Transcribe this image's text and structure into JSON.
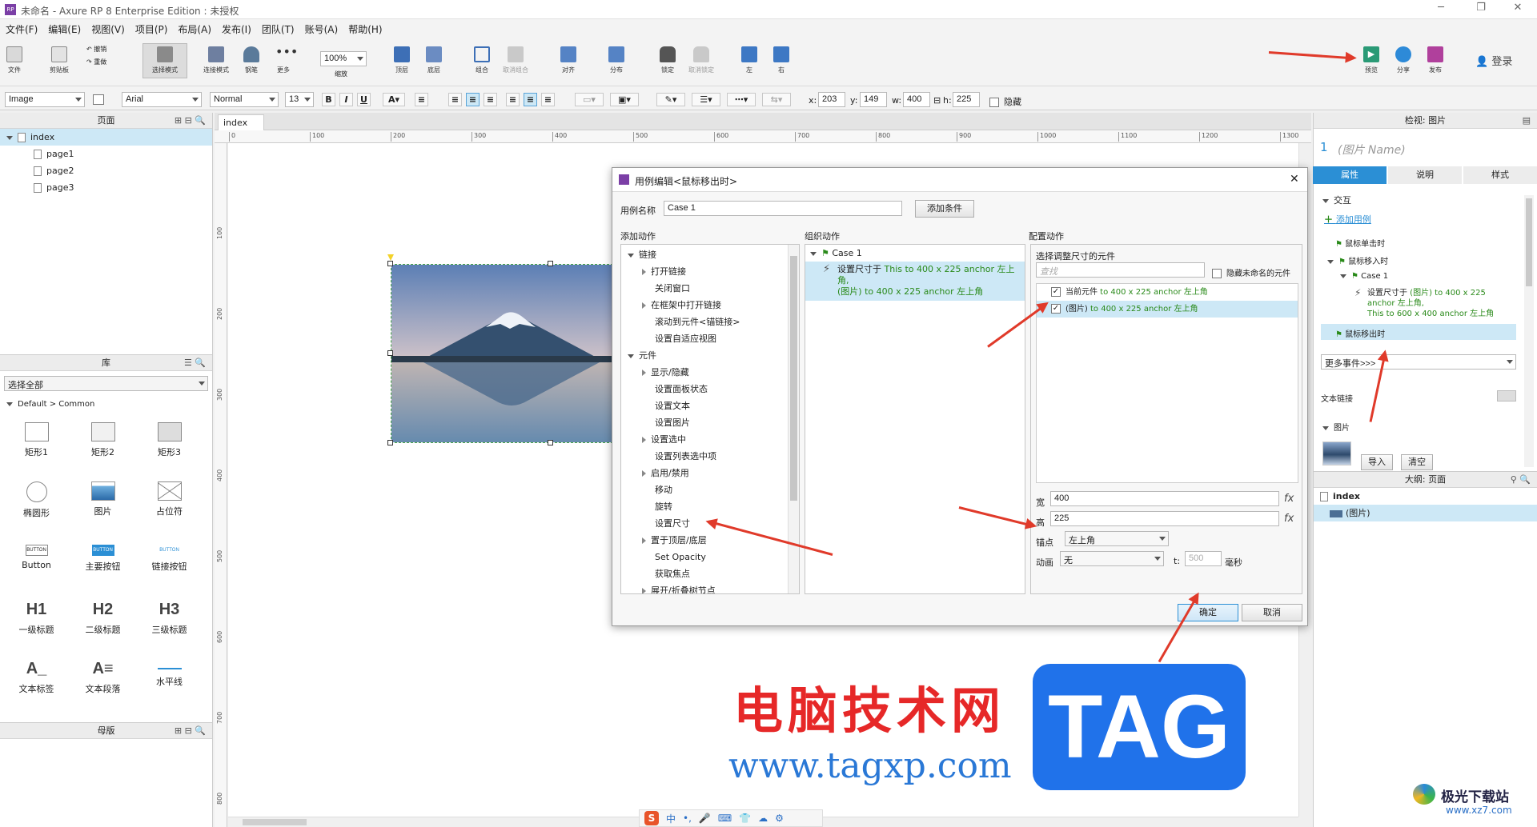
{
  "window": {
    "title": "未命名 - Axure RP 8 Enterprise Edition : 未授权",
    "logo": "RP"
  },
  "menu": [
    "文件(F)",
    "编辑(E)",
    "视图(V)",
    "项目(P)",
    "布局(A)",
    "发布(I)",
    "团队(T)",
    "账号(A)",
    "帮助(H)"
  ],
  "toolbar": {
    "file": "文件",
    "clipboard": "剪贴板",
    "undo": "撤销",
    "redo": "重做",
    "select_mode": "选择模式",
    "connect_mode": "连接模式",
    "pen": "钢笔",
    "more": "更多",
    "zoom_value": "100%",
    "zoom_label": "缩放",
    "top": "顶层",
    "bottom": "底层",
    "group": "组合",
    "ungroup": "取消组合",
    "align": "对齐",
    "distribute": "分布",
    "lock": "锁定",
    "unlock": "取消锁定",
    "left": "左",
    "right": "右",
    "preview": "预览",
    "share": "分享",
    "publish": "发布",
    "login": "登录"
  },
  "format": {
    "widget_type": "Image",
    "font": "Arial",
    "style": "Normal",
    "size": "13",
    "x_label": "x:",
    "x": "203",
    "y_label": "y:",
    "y": "149",
    "w_label": "w:",
    "w": "400",
    "h_label": "h:",
    "h": "225",
    "hidden": "隐藏"
  },
  "pages_panel": {
    "title": "页面",
    "root": "index",
    "pages": [
      "page1",
      "page2",
      "page3"
    ]
  },
  "library_panel": {
    "title": "库",
    "select": "选择全部",
    "group": "Default > Common",
    "widgets": [
      {
        "label": "矩形1",
        "icon": "rect-icon"
      },
      {
        "label": "矩形2",
        "icon": "rect-icon"
      },
      {
        "label": "矩形3",
        "icon": "rect-icon"
      },
      {
        "label": "椭圆形",
        "icon": "ellipse-icon"
      },
      {
        "label": "图片",
        "icon": "image-icon"
      },
      {
        "label": "占位符",
        "icon": "placeholder-icon"
      },
      {
        "label": "Button",
        "icon": "button-icon",
        "text": "BUTTON"
      },
      {
        "label": "主要按钮",
        "icon": "primary-button-icon",
        "text": "BUTTON"
      },
      {
        "label": "链接按钮",
        "icon": "link-button-icon",
        "text": "BUTTON"
      },
      {
        "label": "一级标题",
        "icon": "h1-icon",
        "text": "H1"
      },
      {
        "label": "二级标题",
        "icon": "h2-icon",
        "text": "H2"
      },
      {
        "label": "三级标题",
        "icon": "h3-icon",
        "text": "H3"
      },
      {
        "label": "文本标签",
        "icon": "text-label-icon",
        "text": "A_"
      },
      {
        "label": "文本段落",
        "icon": "paragraph-icon",
        "text": "A≡"
      },
      {
        "label": "水平线",
        "icon": "hline-icon"
      }
    ]
  },
  "masters_panel": {
    "title": "母版"
  },
  "canvas": {
    "tab": "index",
    "ruler_h": [
      "0",
      "100",
      "200",
      "300",
      "400",
      "500",
      "600",
      "700",
      "800",
      "900",
      "1000",
      "1100",
      "1200",
      "1300"
    ],
    "ruler_v": [
      "100",
      "200",
      "300",
      "400",
      "500",
      "600",
      "700",
      "800"
    ]
  },
  "dialog": {
    "title": "用例编辑<鼠标移出时>",
    "case_name_label": "用例名称",
    "case_name": "Case 1",
    "add_condition": "添加条件",
    "add_action_title": "添加动作",
    "organize_title": "组织动作",
    "config_title": "配置动作",
    "actions": [
      {
        "label": "链接",
        "level": 0,
        "expanded": true
      },
      {
        "label": "打开链接",
        "level": 1,
        "arrow": true
      },
      {
        "label": "关闭窗口",
        "level": 1
      },
      {
        "label": "在框架中打开链接",
        "level": 1,
        "arrow": true
      },
      {
        "label": "滚动到元件<锚链接>",
        "level": 1
      },
      {
        "label": "设置自适应视图",
        "level": 1
      },
      {
        "label": "元件",
        "level": 0,
        "expanded": true
      },
      {
        "label": "显示/隐藏",
        "level": 1,
        "arrow": true
      },
      {
        "label": "设置面板状态",
        "level": 1
      },
      {
        "label": "设置文本",
        "level": 1
      },
      {
        "label": "设置图片",
        "level": 1
      },
      {
        "label": "设置选中",
        "level": 1,
        "arrow": true
      },
      {
        "label": "设置列表选中项",
        "level": 1
      },
      {
        "label": "启用/禁用",
        "level": 1,
        "arrow": true
      },
      {
        "label": "移动",
        "level": 1
      },
      {
        "label": "旋转",
        "level": 1
      },
      {
        "label": "设置尺寸",
        "level": 1
      },
      {
        "label": "置于顶层/底层",
        "level": 1,
        "arrow": true
      },
      {
        "label": "Set Opacity",
        "level": 1
      },
      {
        "label": "获取焦点",
        "level": 1
      },
      {
        "label": "展开/折叠树节点",
        "level": 1,
        "arrow": true
      }
    ],
    "organize_case": "Case 1",
    "organize_action": {
      "prefix": "设置尺寸于",
      "line1": " This to 400 x 225 anchor 左上角,",
      "line2": "(图片) to 400 x 225 anchor 左上角"
    },
    "select_title": "选择调整尺寸的元件",
    "search_placeholder": "查找",
    "hide_unnamed": "隐藏未命名的元件",
    "targets": [
      {
        "name": "当前元件",
        "detail": " to 400 x 225 anchor 左上角",
        "checked": true
      },
      {
        "name": "(图片)",
        "detail": " to 400 x 225 anchor 左上角",
        "checked": true
      }
    ],
    "width_label": "宽",
    "width": "400",
    "height_label": "高",
    "height": "225",
    "fx": "fx",
    "anchor_label": "锚点",
    "anchor": "左上角",
    "animation_label": "动画",
    "animation": "无",
    "t_label": "t:",
    "t_value": "500",
    "ms": "毫秒",
    "ok": "确定",
    "cancel": "取消"
  },
  "inspector": {
    "title": "检视: 图片",
    "index_num": "1",
    "name_placeholder": "(图片 Name)",
    "tabs": [
      "属性",
      "说明",
      "样式"
    ],
    "interaction": "交互",
    "add_case": "添加用例",
    "events": [
      {
        "label": "鼠标单击时",
        "level": 1
      },
      {
        "label": "鼠标移入时",
        "level": 1,
        "expanded": true
      },
      {
        "label": "Case 1",
        "level": 2
      },
      {
        "label": "鼠标移出时",
        "level": 1,
        "selected": true
      }
    ],
    "event_action": {
      "prefix": "设置尺寸于",
      "line1": " (图片) to 400 x 225",
      "line2": "anchor 左上角,",
      "line3": "This to 600 x 400 anchor 左上角"
    },
    "more_events": "更多事件>>>",
    "text_link": "文本链接",
    "image_section": "图片",
    "import": "导入",
    "clear": "清空"
  },
  "outline": {
    "title": "大纲: 页面",
    "root": "index",
    "child": "(图片)"
  },
  "watermark": {
    "text_cn": "电脑技术网",
    "url": "www.tagxp.com",
    "tag": "TAG",
    "site2": "极光下载站",
    "site2_url": "www.xz7.com"
  },
  "ime": [
    "中",
    "•,",
    "🎤",
    "⌨",
    "👕",
    "☁",
    "⚙"
  ],
  "colors": {
    "accent": "#2b8fd5",
    "arrow": "#e03a2a",
    "selection": "#cde8f6",
    "green": "#2a8a1a"
  }
}
